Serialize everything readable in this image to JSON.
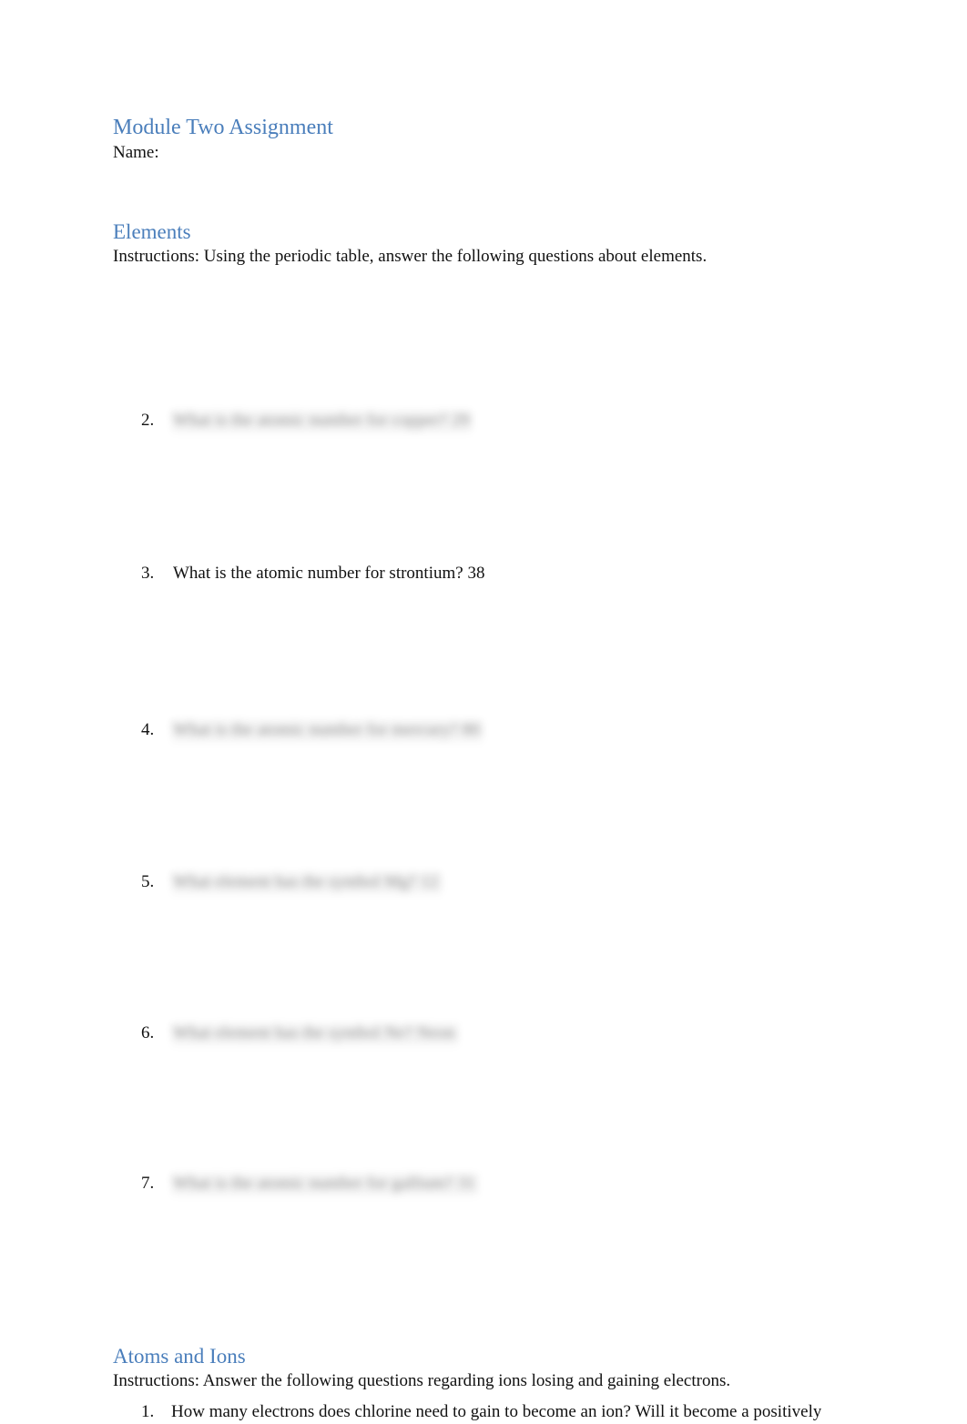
{
  "document": {
    "title": "Module Two Assignment",
    "name_label": "Name:",
    "heading_color": "#4a7ebb",
    "body_color": "#111111",
    "page_background": "#ffffff"
  },
  "sections": [
    {
      "id": "elements",
      "heading": "Elements",
      "instructions": "Instructions: Using the periodic table, answer the following questions about elements.",
      "questions": [
        {
          "number": "2.",
          "text": "What is the atomic number for copper? 29",
          "redacted": true
        },
        {
          "number": "3.",
          "text": "What is the atomic number for strontium? 38",
          "redacted": false
        },
        {
          "number": "4.",
          "text": "What is the atomic number for mercury? 80",
          "redacted": true
        },
        {
          "number": "5.",
          "text": "What element has the symbol Mg? 12",
          "redacted": true
        },
        {
          "number": "6.",
          "text": "What element has the symbol Ne? Neon",
          "redacted": true
        },
        {
          "number": "7.",
          "text": "What is the atomic number for gallium? 31",
          "redacted": true
        }
      ]
    },
    {
      "id": "atoms-and-ions",
      "heading": "Atoms and Ions",
      "instructions": "Instructions: Answer the following questions regarding ions losing and gaining electrons.",
      "questions": [
        {
          "number": "1.",
          "text": "How many electrons does chlorine need to gain to become an ion? Will it become a positively",
          "redacted": false
        }
      ]
    }
  ]
}
